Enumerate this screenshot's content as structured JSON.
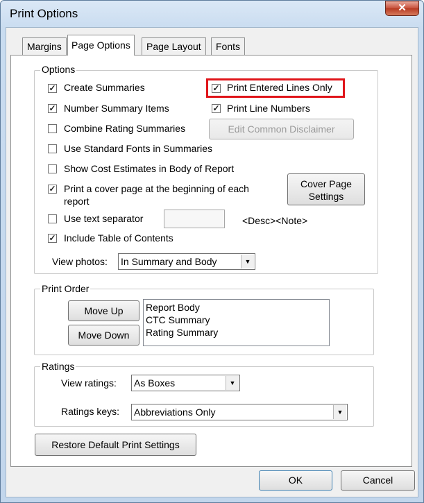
{
  "window": {
    "title": "Print Options",
    "close_glyph": "✕"
  },
  "tabs": [
    "Margins",
    "Page Options",
    "Page Layout",
    "Fonts"
  ],
  "options": {
    "label": "Options",
    "create_summaries": "Create Summaries",
    "print_entered_lines_only": "Print Entered Lines Only",
    "number_summary_items": "Number Summary Items",
    "print_line_numbers": "Print Line Numbers",
    "combine_rating_summaries": "Combine Rating Summaries",
    "edit_common_disclaimer": "Edit Common Disclaimer",
    "use_standard_fonts": "Use Standard Fonts in Summaries",
    "show_cost_estimates": "Show Cost Estimates in Body of Report",
    "cover_page_line1": "Print a cover page at the beginning of each",
    "cover_page_line2": "report",
    "cover_page_settings_line1": "Cover Page",
    "cover_page_settings_line2": "Settings",
    "use_text_separator": "Use text separator",
    "separator_hint": "<Desc><Note>",
    "include_toc": "Include Table of Contents",
    "view_photos_label": "View photos:",
    "view_photos_value": "In Summary and Body",
    "check_glyph": "✓"
  },
  "print_order": {
    "label": "Print Order",
    "move_up": "Move Up",
    "move_down": "Move Down",
    "items": [
      "Report Body",
      "CTC Summary",
      "Rating Summary"
    ]
  },
  "ratings": {
    "label": "Ratings",
    "view_ratings_label": "View ratings:",
    "view_ratings_value": "As Boxes",
    "ratings_keys_label": "Ratings keys:",
    "ratings_keys_value": "Abbreviations Only"
  },
  "restore_button": "Restore Default Print Settings",
  "footer": {
    "ok": "OK",
    "cancel": "Cancel"
  },
  "colors": {
    "highlight": "#e0151a",
    "close_button": "#c7503a"
  }
}
